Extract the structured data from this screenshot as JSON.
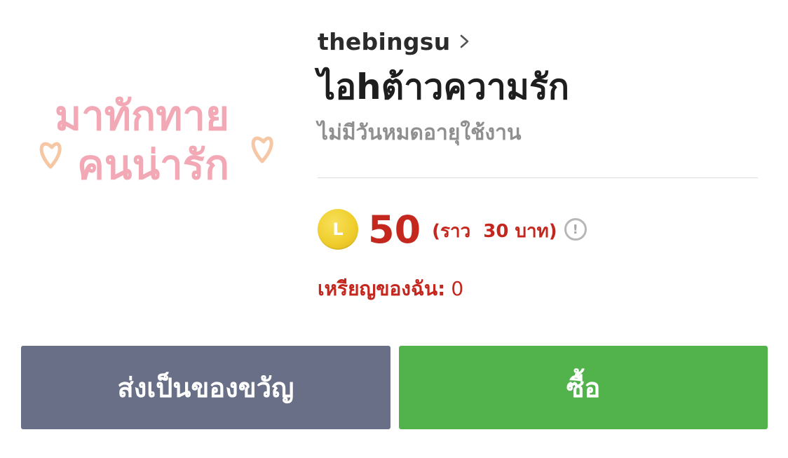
{
  "sticker": {
    "line1": "มาทักทาย",
    "line2": "คนน่ารัก"
  },
  "product": {
    "author": "thebingsu",
    "title": "ไอhต้าวความรัก",
    "validity": "ไม่มีวันหมดอายุใช้งาน"
  },
  "price": {
    "coin_letter": "L",
    "amount": "50",
    "approx": "(ราว  30 บาท)",
    "info_symbol": "!"
  },
  "my_coins": {
    "label": "เหรียญของฉัน:",
    "value": "0"
  },
  "buttons": {
    "gift_label": "ส่งเป็นของขวัญ",
    "buy_label": "ซื้อ"
  },
  "colors": {
    "accent_red": "#c4271e",
    "gift_button": "#686f86",
    "buy_button": "#52b34d",
    "coin_gold": "#efcc2a"
  }
}
